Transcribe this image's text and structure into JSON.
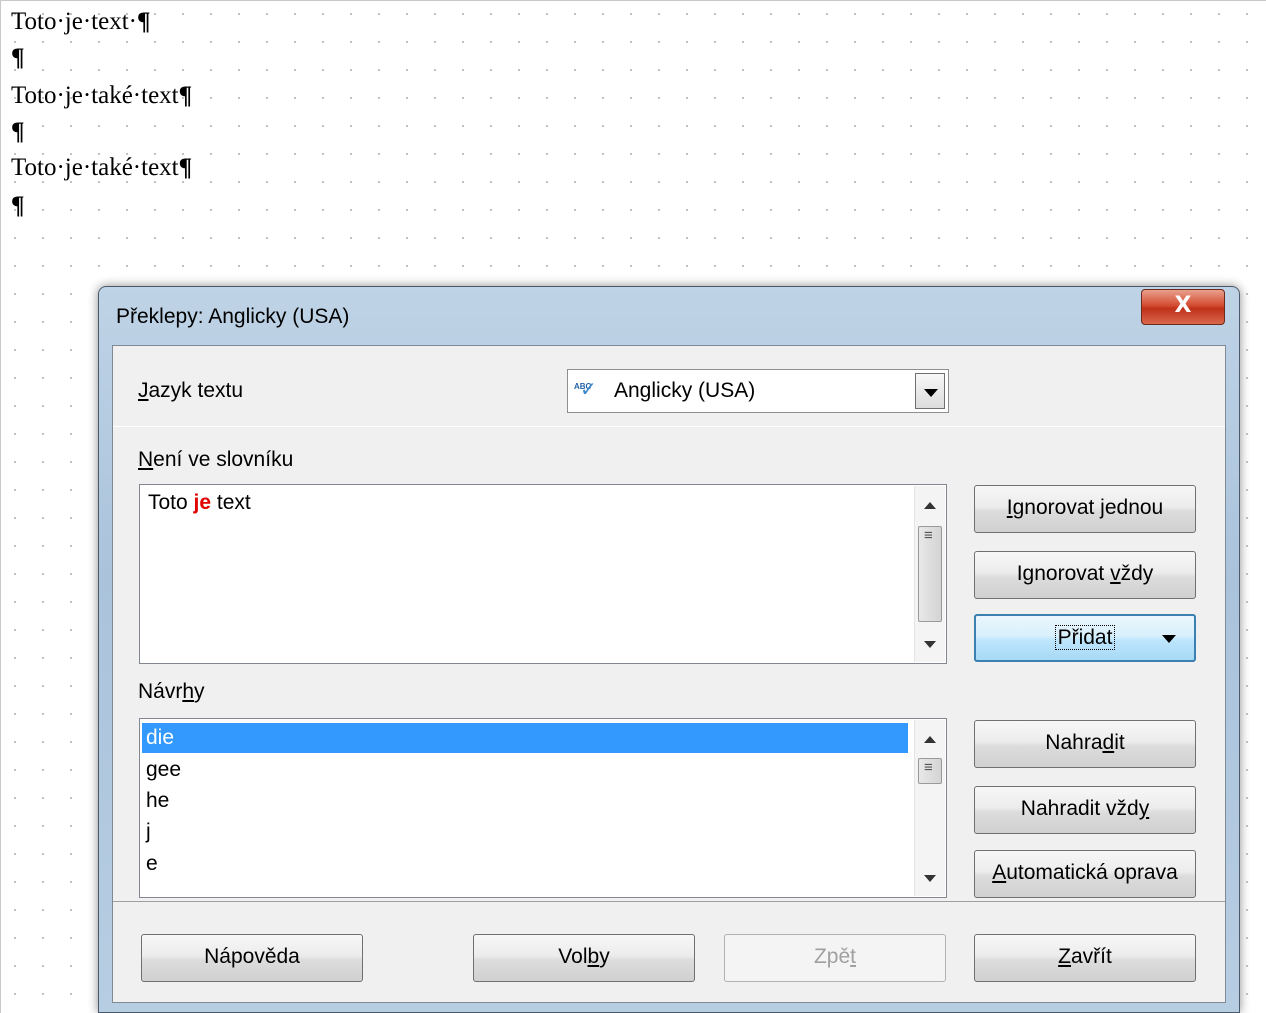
{
  "document": {
    "paragraphs": [
      "Toto·je·text·",
      "",
      "Toto·je·také·text",
      "",
      "Toto·je·také·text",
      ""
    ],
    "pilcrow": "¶"
  },
  "dialog": {
    "title": "Překlepy: Anglicky (USA)",
    "close_label": "X",
    "language": {
      "label_prefix": "",
      "label_underline": "J",
      "label_rest": "azyk textu",
      "value": "Anglicky (USA)",
      "icon": "spellcheck-abc-icon",
      "icon_text": "ABC"
    },
    "not_in_dictionary": {
      "label_underline": "N",
      "label_rest": "ení ve slovníku",
      "sentence_before": "Toto ",
      "sentence_error": "je",
      "sentence_after": " text"
    },
    "suggestions": {
      "label_prefix": "Návr",
      "label_underline": "h",
      "label_rest": "y",
      "items": [
        "die",
        "gee",
        "he",
        "j",
        "e"
      ],
      "selected": "die"
    },
    "buttons": {
      "ignore_once_underline": "I",
      "ignore_once_rest": "gnorovat jednou",
      "ignore_all_prefix": "Ignorovat ",
      "ignore_all_underline": "v",
      "ignore_all_rest": "ždy",
      "add": "Přidat",
      "replace_prefix": "Nahra",
      "replace_underline": "d",
      "replace_rest": "it",
      "replace_all_prefix": "Nahradit vžd",
      "replace_all_underline": "y",
      "autocorrect_underline": "A",
      "autocorrect_rest": "utomatická oprava",
      "help": "Nápověda",
      "options_prefix": "Vol",
      "options_underline": "b",
      "options_rest": "y",
      "undo_prefix": "Zpě",
      "undo_underline": "t",
      "close_underline": "Z",
      "close_rest": "avřít"
    }
  }
}
